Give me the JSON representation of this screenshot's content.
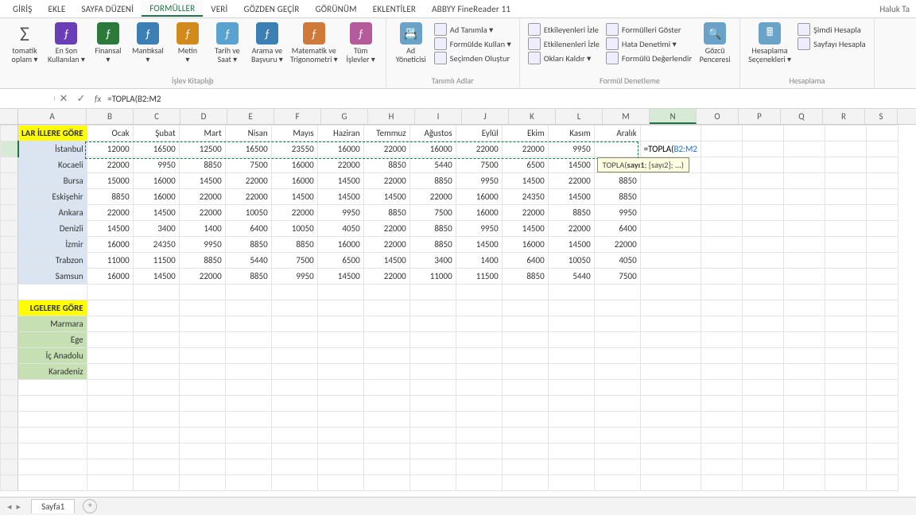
{
  "tabs": [
    "GİRİŞ",
    "EKLE",
    "SAYFA DÜZENİ",
    "FORMÜLLER",
    "VERİ",
    "GÖZDEN GEÇİR",
    "GÖRÜNÜM",
    "EKLENTİLER",
    "ABBYY FineReader 11"
  ],
  "active_tab": 3,
  "user": "Haluk Ta",
  "ribbon": {
    "g1": {
      "caption": "İşlev Kitaplığı",
      "btns": [
        {
          "l": "tomatik\noplam ▾",
          "c": "#444",
          "big": "Σ"
        },
        {
          "l": "En Son\nKullanılan ▾",
          "c": "#6a3fb5"
        },
        {
          "l": "Finansal\n▾",
          "c": "#2b7a3b"
        },
        {
          "l": "Mantıksal\n▾",
          "c": "#3b7fb5"
        },
        {
          "l": "Metin\n▾",
          "c": "#d28a1a"
        },
        {
          "l": "Tarih ve\nSaat ▾",
          "c": "#5aa3d0"
        },
        {
          "l": "Arama ve\nBaşvuru ▾",
          "c": "#3b7fb5"
        },
        {
          "l": "Matematik ve\nTrigonometri ▾",
          "c": "#d07a3a"
        },
        {
          "l": "Tüm\nİşlevler ▾",
          "c": "#b55a9a"
        }
      ]
    },
    "g2": {
      "caption": "Tanımlı Adlar",
      "btn": {
        "l": "Ad\nYöneticisi",
        "c": "#6aa3c7"
      },
      "rows": [
        "Ad Tanımla ▾",
        "Formülde Kullan ▾",
        "Seçimden Oluştur"
      ]
    },
    "g3": {
      "caption": "Formül Denetleme",
      "col1": [
        "Etkileyenleri İzle",
        "Etkilenenleri İzle",
        "Okları Kaldır ▾"
      ],
      "col2": [
        "Formülleri Göster",
        "Hata Denetimi ▾",
        "Formülü Değerlendir"
      ],
      "btn": {
        "l": "Gözcü\nPenceresi",
        "c": "#6aa3c7"
      }
    },
    "g4": {
      "caption": "Hesaplama",
      "btn": {
        "l": "Hesaplama\nSeçenekleri ▾",
        "c": "#6aa3c7"
      },
      "rows": [
        "Şimdi Hesapla",
        "Sayfayı Hesapla"
      ]
    }
  },
  "namebox": "",
  "formula": "=TOPLA(B2:M2",
  "cols": [
    "A",
    "B",
    "C",
    "D",
    "E",
    "F",
    "G",
    "H",
    "I",
    "J",
    "K",
    "L",
    "M",
    "N",
    "O",
    "P",
    "Q",
    "R",
    "S"
  ],
  "selected_col": 13,
  "header_row": [
    "LAR İLLERE GÖRE",
    "Ocak",
    "Şubat",
    "Mart",
    "Nisan",
    "Mayıs",
    "Haziran",
    "Temmuz",
    "Ağustos",
    "Eylül",
    "Ekim",
    "Kasım",
    "Aralık"
  ],
  "data": [
    [
      "İstanbul",
      12000,
      16500,
      12500,
      16500,
      23550,
      16000,
      22000,
      16000,
      22000,
      22000,
      9950
    ],
    [
      "Kocaeli",
      22000,
      9950,
      8850,
      7500,
      16000,
      22000,
      8850,
      5440,
      7500,
      6500,
      14500
    ],
    [
      "Bursa",
      15000,
      16000,
      14500,
      22000,
      16000,
      14500,
      22000,
      8850,
      9950,
      14500,
      22000,
      8850
    ],
    [
      "Eskişehir",
      8850,
      16000,
      22000,
      22000,
      14500,
      14500,
      14500,
      22000,
      16000,
      24350,
      14500,
      8850
    ],
    [
      "Ankara",
      22000,
      14500,
      22000,
      10050,
      22000,
      9950,
      8850,
      7500,
      16000,
      22000,
      8850,
      9950
    ],
    [
      "Denizli",
      14500,
      3400,
      1400,
      6400,
      10050,
      4050,
      22000,
      8850,
      9950,
      14500,
      22000,
      6400
    ],
    [
      "İzmir",
      16000,
      24350,
      9950,
      8850,
      8850,
      16000,
      22000,
      8850,
      14500,
      16000,
      14500,
      22000
    ],
    [
      "Trabzon",
      11000,
      11500,
      8850,
      5440,
      7500,
      6500,
      14500,
      3400,
      1400,
      6400,
      10050,
      4050
    ],
    [
      "Samsun",
      16000,
      14500,
      22000,
      8850,
      9950,
      14500,
      22000,
      11000,
      11500,
      8850,
      5440,
      7500
    ]
  ],
  "section2_hdr": "LGELERE GÖRE",
  "regions": [
    "Marmara",
    "Ege",
    "İç Anadolu",
    "Karadeniz"
  ],
  "formula_display": {
    "p1": "=TOPLA(",
    "p2": "B2:M2"
  },
  "tooltip": "TOPLA(sayı1; [sayı2]; ...)",
  "tooltip_bold": "sayı1",
  "sheet": "Sayfa1"
}
